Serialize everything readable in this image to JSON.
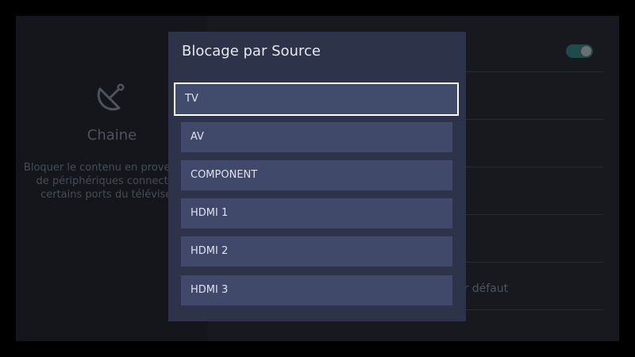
{
  "background": {
    "section_title": "Chaine",
    "description": "Bloquer le contenu en provenance de périphériques connectés à certains ports du téléviseur.",
    "default_row_label": "ar défaut",
    "toggle_state": "on",
    "icon": "satellite-dish-icon"
  },
  "dialog": {
    "title": "Blocage par Source",
    "options": [
      {
        "label": "TV",
        "focused": true
      },
      {
        "label": "AV",
        "focused": false
      },
      {
        "label": "COMPONENT",
        "focused": false
      },
      {
        "label": "HDMI 1",
        "focused": false
      },
      {
        "label": "HDMI 2",
        "focused": false
      },
      {
        "label": "HDMI 3",
        "focused": false
      }
    ]
  },
  "colors": {
    "dialog_bg": "#2d3348",
    "option_bg": "#40496a",
    "focus_border": "#ffffff",
    "toggle_on": "#1f4b4a"
  }
}
